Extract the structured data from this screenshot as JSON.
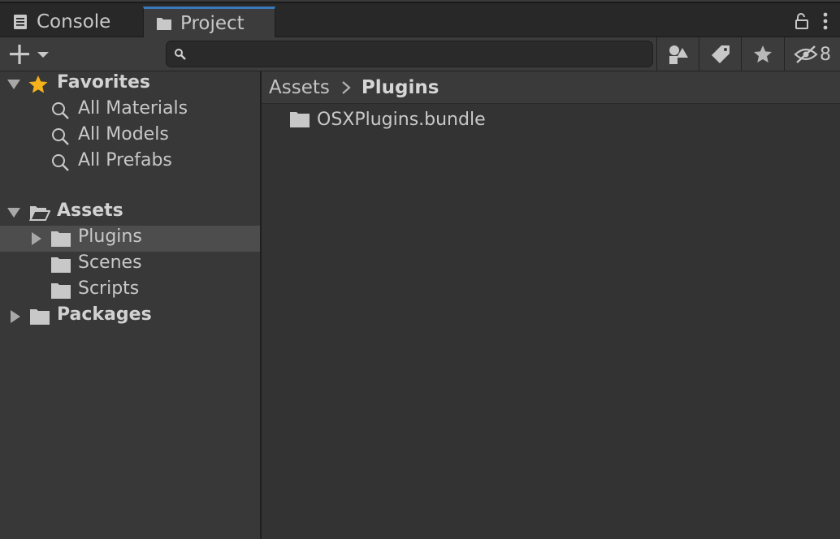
{
  "tabs": {
    "console": {
      "label": "Console",
      "icon": "console-icon"
    },
    "project": {
      "label": "Project",
      "icon": "folder-icon",
      "active": true
    }
  },
  "window_controls": {
    "lock_icon": "lock-icon",
    "menu_icon": "kebab-menu-icon"
  },
  "toolbar": {
    "create_icon": "plus-icon",
    "search": {
      "value": "",
      "placeholder": ""
    },
    "filter_type_icon": "search-by-type-icon",
    "filter_label_icon": "search-by-label-icon",
    "favorite_icon": "star-icon",
    "hidden_packages_icon": "eye-hidden-icon",
    "hidden_packages_count": "8"
  },
  "tree": {
    "favorites": {
      "label": "Favorites",
      "items": [
        "All Materials",
        "All Models",
        "All Prefabs"
      ]
    },
    "assets": {
      "label": "Assets",
      "items": [
        "Plugins",
        "Scenes",
        "Scripts"
      ],
      "selected": "Plugins"
    },
    "packages": {
      "label": "Packages"
    }
  },
  "breadcrumb": {
    "root": "Assets",
    "current": "Plugins"
  },
  "files": [
    {
      "name": "OSXPlugins.bundle",
      "icon": "folder-icon"
    }
  ],
  "colors": {
    "accent": "#3a79bb",
    "star": "#f4b31a",
    "panel": "#383838",
    "content": "#333333",
    "selected_row": "#4d4d4d"
  }
}
